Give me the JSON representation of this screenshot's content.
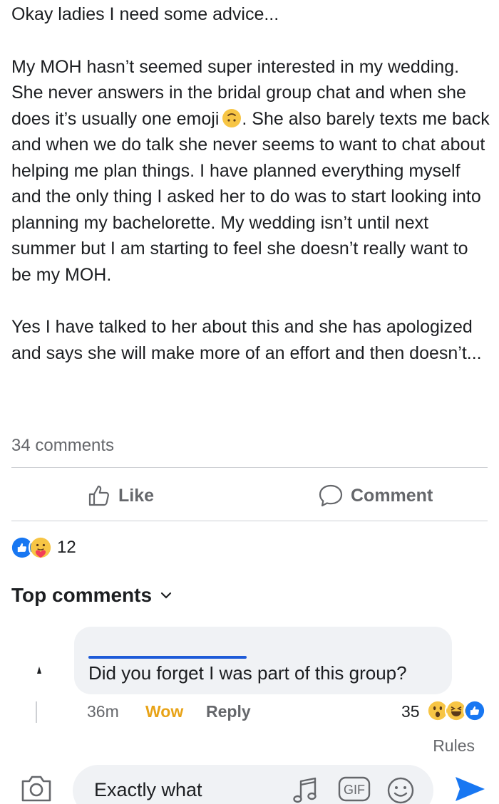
{
  "post": {
    "paragraph1_line1": "Okay ladies I need some advice...",
    "paragraph2_a": "My MOH hasn’t seemed super interested in my wedding. She never answers in the bridal group chat and when she does it’s usually one emoji",
    "paragraph2_b": ". She also barely texts me back and when we do talk she never seems to want to chat about helping me plan things. I have planned everything myself and the only thing I asked her to do was to start looking into planning my bachelorette. My wedding isn’t until next summer but I am starting to feel she doesn’t really want to be my MOH.",
    "paragraph3": "Yes I have talked to her about this and she has apologized and says she will make more of an effort and then doesn’t...",
    "inline_emoji": "upside-down-face-icon",
    "comments_count": "34 comments"
  },
  "actions": {
    "like_label": "Like",
    "comment_label": "Comment"
  },
  "reactions": {
    "icons": [
      "like-reaction-icon",
      "care-reaction-icon"
    ],
    "count": "12"
  },
  "top_comments": {
    "label": "Top comments",
    "chevron": "chevron-down-icon"
  },
  "comment": {
    "text": "Did you forget I was part of this group?",
    "time": "36m",
    "wow_label": "Wow",
    "reply_label": "Reply",
    "reaction_count": "35",
    "reaction_icons": [
      "wow-reaction-icon",
      "haha-reaction-icon",
      "like-reaction-icon"
    ]
  },
  "rules_label": "Rules",
  "composer": {
    "text": "Exactly what",
    "icons": [
      "camera-icon",
      "music-icon",
      "gif-icon",
      "emoji-icon",
      "send-icon"
    ]
  },
  "colors": {
    "accent": "#1877f2",
    "wow": "#e8a317",
    "muted": "#65676b",
    "bubble": "#f0f2f5"
  }
}
